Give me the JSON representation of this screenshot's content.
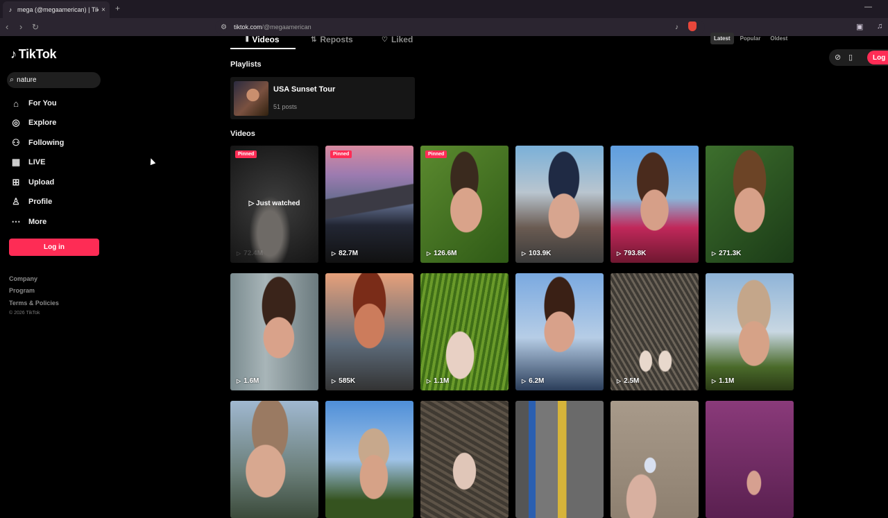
{
  "browser": {
    "tab_title": "mega (@megaamerican) | TikTok",
    "tab_close": "×",
    "new_tab": "+",
    "url_host": "tiktok.com",
    "url_path": "/@megaamerican",
    "minimize": "—"
  },
  "sidebar": {
    "logo": "TikTok",
    "search_value": "nature",
    "items": [
      {
        "label": "For You",
        "icon": "home-icon"
      },
      {
        "label": "Explore",
        "icon": "compass-icon"
      },
      {
        "label": "Following",
        "icon": "following-icon"
      },
      {
        "label": "LIVE",
        "icon": "live-icon"
      },
      {
        "label": "Upload",
        "icon": "upload-icon"
      },
      {
        "label": "Profile",
        "icon": "profile-icon"
      },
      {
        "label": "More",
        "icon": "more-icon"
      }
    ],
    "login": "Log in",
    "footer": [
      "Company",
      "Program",
      "Terms & Policies"
    ],
    "copyright": "© 2026 TikTok"
  },
  "main": {
    "tabs": [
      {
        "label": "Videos",
        "icon": "grid-icon"
      },
      {
        "label": "Reposts",
        "icon": "repost-icon"
      },
      {
        "label": "Liked",
        "icon": "heart-icon"
      }
    ],
    "sort": [
      "Latest",
      "Popular",
      "Oldest"
    ],
    "sort_active": "Latest",
    "login_partial": "Log",
    "playlists_title": "Playlists",
    "playlist": {
      "name": "USA Sunset Tour",
      "count": "51 posts"
    },
    "videos_title": "Videos",
    "pinned_label": "Pinned",
    "just_watched": "Just watched",
    "videos": [
      {
        "views": "72.4M",
        "pinned": true
      },
      {
        "views": "82.7M",
        "pinned": true
      },
      {
        "views": "126.6M",
        "pinned": true
      },
      {
        "views": "103.9K",
        "pinned": false
      },
      {
        "views": "793.8K",
        "pinned": false
      },
      {
        "views": "271.3K",
        "pinned": false
      },
      {
        "views": "1.6M",
        "pinned": false
      },
      {
        "views": "585K",
        "pinned": false
      },
      {
        "views": "1.1M",
        "pinned": false
      },
      {
        "views": "6.2M",
        "pinned": false
      },
      {
        "views": "2.5M",
        "pinned": false
      },
      {
        "views": "1.1M",
        "pinned": false
      },
      {
        "views": "",
        "pinned": false
      },
      {
        "views": "",
        "pinned": false
      },
      {
        "views": "",
        "pinned": false
      },
      {
        "views": "",
        "pinned": false
      },
      {
        "views": "",
        "pinned": false
      },
      {
        "views": "",
        "pinned": false
      }
    ]
  }
}
